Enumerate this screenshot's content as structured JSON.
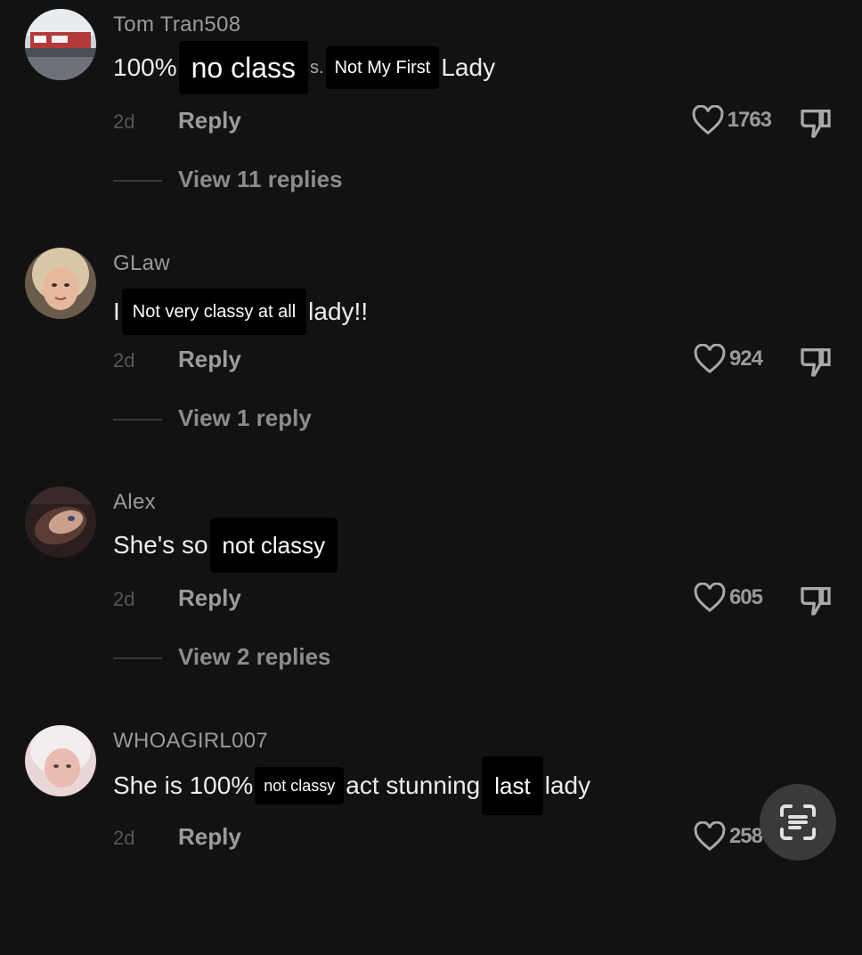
{
  "comments": [
    {
      "username": "Tom Tran508",
      "body": [
        "100% ",
        "no class",
        "s. ",
        "Not My First",
        " Lady"
      ],
      "time": "2d",
      "reply_label": "Reply",
      "likes": "1763",
      "view_replies": "View 11 replies"
    },
    {
      "username": "GLaw",
      "body": [
        "I ",
        "Not very classy at all",
        " lady!!"
      ],
      "time": "2d",
      "reply_label": "Reply",
      "likes": "924",
      "view_replies": "View 1 reply"
    },
    {
      "username": "Alex",
      "body": [
        "She's so ",
        "not classy",
        ""
      ],
      "time": "2d",
      "reply_label": "Reply",
      "likes": "605",
      "view_replies": "View 2 replies"
    },
    {
      "username": "WHOAGIRL007",
      "body": [
        "She is 100% ",
        "not classy",
        " act stunning ",
        "last",
        " lady"
      ],
      "time": "2d",
      "reply_label": "Reply",
      "likes": "258",
      "view_replies": ""
    }
  ],
  "icons": {
    "like": "heart-outline-icon",
    "dislike": "thumbs-down-icon",
    "scan": "text-scan-icon"
  },
  "colors": {
    "background": "#121212",
    "username": "#9a9a9a",
    "body": "#ececec",
    "muted": "#8c8c8c"
  }
}
